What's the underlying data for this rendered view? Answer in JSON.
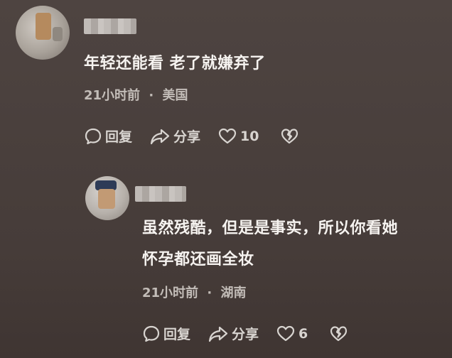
{
  "comments": [
    {
      "text": "年轻还能看 老了就嫌弃了",
      "time": "21小时前",
      "separator": "·",
      "location": "美国",
      "reply_label": "回复",
      "share_label": "分享",
      "like_count": "10"
    },
    {
      "text_line1": "虽然残酷，但是是事实，所以你看她",
      "text_line2": "怀孕都还画全妆",
      "time": "21小时前",
      "separator": "·",
      "location": "湖南",
      "reply_label": "回复",
      "share_label": "分享",
      "like_count": "6"
    }
  ],
  "icons": [
    "comment-bubble-icon",
    "share-arrow-icon",
    "heart-icon",
    "broken-heart-icon"
  ]
}
